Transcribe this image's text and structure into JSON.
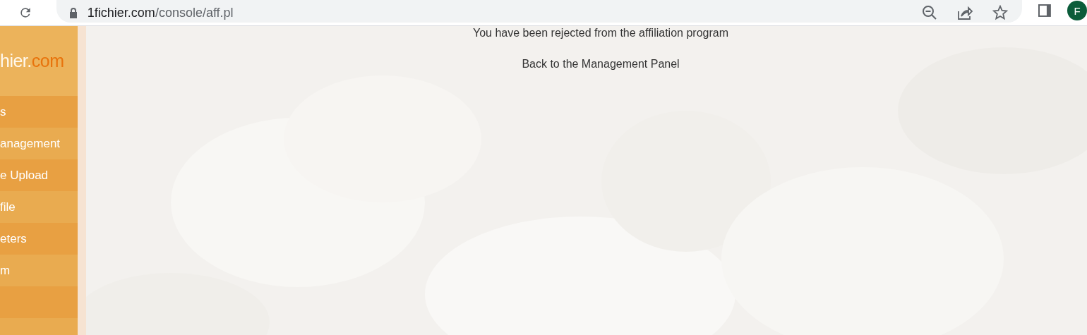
{
  "browser": {
    "url_host": "1fichier.com",
    "url_path": "/console/aff.pl",
    "profile_initial": "F"
  },
  "sidebar": {
    "logo": {
      "name_part": "hier.",
      "domain_part": "com"
    },
    "items": [
      {
        "kind": "link",
        "label": "s"
      },
      {
        "kind": "link",
        "label": "anagement"
      },
      {
        "kind": "link",
        "label": "e Upload"
      },
      {
        "kind": "link",
        "label": "file"
      },
      {
        "kind": "link",
        "label": "eters"
      },
      {
        "kind": "link",
        "label": "m"
      },
      {
        "kind": "blank"
      },
      {
        "kind": "blank"
      }
    ]
  },
  "content": {
    "message": "You have been rejected from the affiliation program",
    "link": "Back to the Management Panel"
  }
}
